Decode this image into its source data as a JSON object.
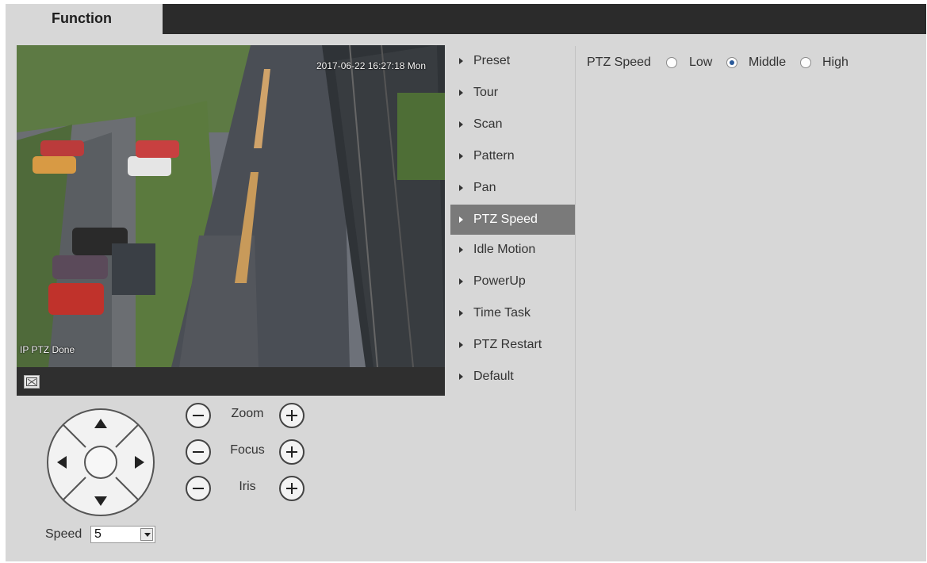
{
  "header": {
    "tab_label": "Function"
  },
  "video": {
    "osd_time": "2017-06-22 16:27:18 Mon",
    "osd_status": "IP PTZ Done",
    "fullscreen_icon": "fullscreen-icon"
  },
  "ptz_controls": {
    "zoom_label": "Zoom",
    "focus_label": "Focus",
    "iris_label": "Iris",
    "speed_label": "Speed",
    "speed_value": "5",
    "direction_icons": [
      "arrow-up-icon",
      "arrow-down-icon",
      "arrow-left-icon",
      "arrow-right-icon"
    ]
  },
  "menu": {
    "items": [
      {
        "label": "Preset"
      },
      {
        "label": "Tour"
      },
      {
        "label": "Scan"
      },
      {
        "label": "Pattern"
      },
      {
        "label": "Pan"
      },
      {
        "label": "PTZ Speed"
      },
      {
        "label": "Idle Motion"
      },
      {
        "label": "PowerUp"
      },
      {
        "label": "Time Task"
      },
      {
        "label": "PTZ Restart"
      },
      {
        "label": "Default"
      }
    ],
    "active_item": "PTZ Speed"
  },
  "settings": {
    "title": "PTZ Speed",
    "options": [
      {
        "label": "Low",
        "checked": false
      },
      {
        "label": "Middle",
        "checked": true
      },
      {
        "label": "High",
        "checked": false
      }
    ]
  },
  "colors": {
    "panel_bg": "#d7d7d7",
    "topbar": "#2b2b2b",
    "active_menu": "#7a7a7a",
    "radio_checked": "#2a5a9a"
  }
}
